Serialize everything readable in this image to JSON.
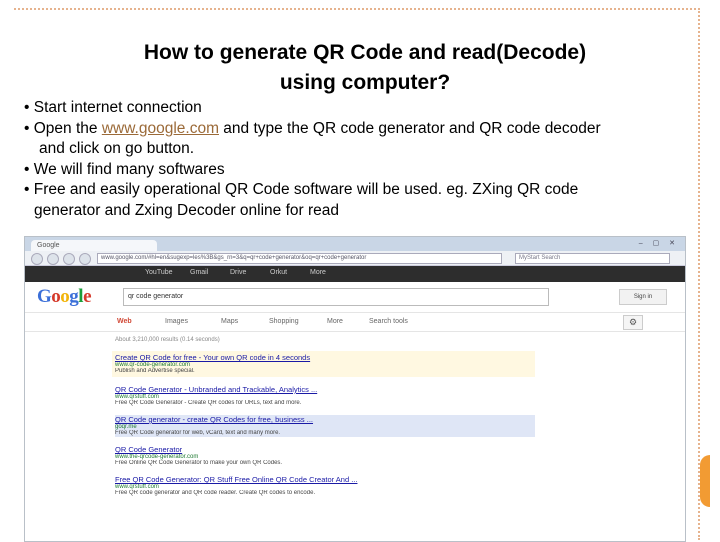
{
  "title_line1": "How to generate QR Code and read(Decode)",
  "title_line2": "using computer?",
  "bullets": {
    "b1": "• Start internet connection",
    "b2_pre": "• Open  the ",
    "b2_link": "www.google.com",
    "b2_post": " and type the QR code generator and QR code decoder",
    "b2_cont": "and click on go button.",
    "b3": "• We will find many softwares",
    "b4": "• Free and easily operational QR Code software will be used. eg. ZXing QR code",
    "b4_cont": "generator and Zxing Decoder online for read"
  },
  "browser": {
    "tab_label": "Google",
    "window_controls": "– ▢ ✕",
    "url": "www.google.com/#hl=en&sugexp=les%3B&gs_rn=3&q=qr+code+generator&oq=qr+code+generator",
    "search_placeholder": "MyStart Search",
    "gbar_items": [
      "YouTube",
      "Gmail",
      "Drive",
      "Orkut",
      "More"
    ],
    "query": "qr code generator",
    "signin": "Sign in",
    "tabs": [
      "Web",
      "Images",
      "Maps",
      "Shopping",
      "More",
      "Search tools"
    ],
    "stats": "About 3,210,000 results (0.14 seconds)",
    "results": [
      {
        "title": "Create QR Code for free - Your own QR code in 4 seconds",
        "url": "www.qr-code-generator.com",
        "snippet": "Publish and Advertise special."
      },
      {
        "title": "QR Code Generator - Unbranded and Trackable, Analytics ...",
        "url": "www.qrstuff.com",
        "snippet": "Free QR Code Generator - Create QR codes for URLs, text and more."
      },
      {
        "title": "QR Code generator - create QR Codes for free, business ...",
        "url": "goqr.me",
        "snippet": "Free QR Code generator for web, vCard, text and many more."
      },
      {
        "title": "QR Code Generator",
        "url": "www.the-qrcode-generator.com",
        "snippet": "Free Online QR Code Generator to make your own QR Codes."
      },
      {
        "title": "Free QR Code Generator: QR Stuff Free Online QR Code Creator And ...",
        "url": "www.qrstuff.com",
        "snippet": "Free QR code generator and QR code reader. Create QR codes to encode."
      }
    ]
  }
}
